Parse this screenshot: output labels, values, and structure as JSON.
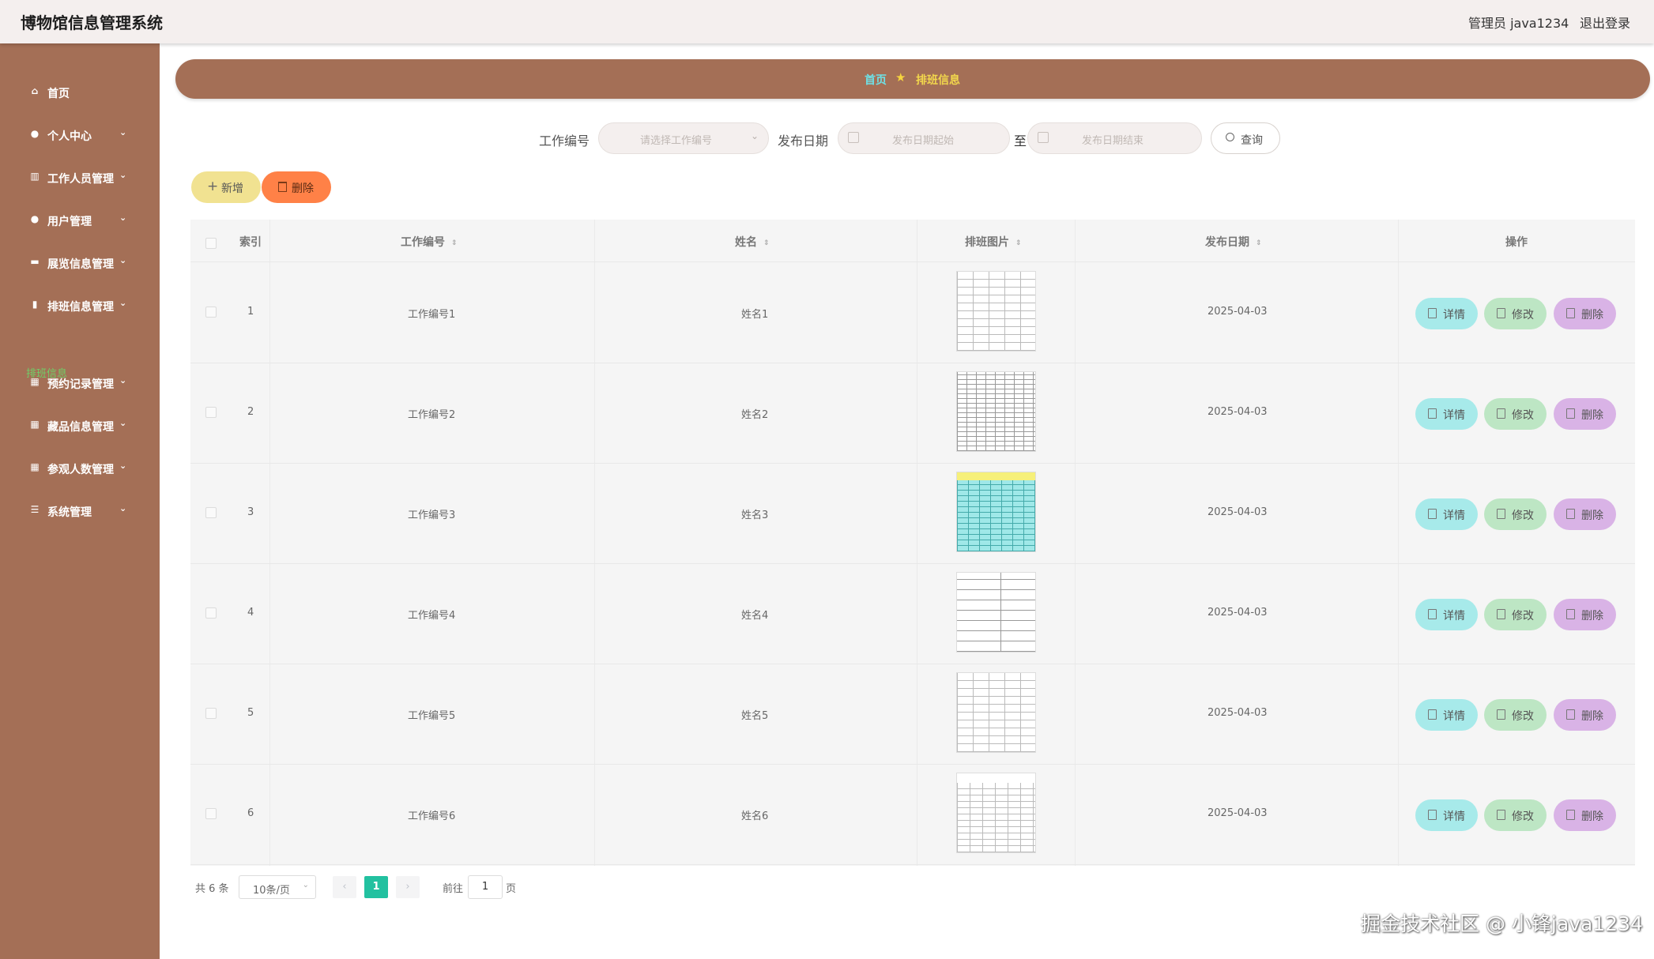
{
  "app": {
    "title": "博物馆信息管理系统",
    "user": "管理员 java1234",
    "logout": "退出登录"
  },
  "sidebar": {
    "items": [
      {
        "label": "首页",
        "icon": "home-icon",
        "expandable": false
      },
      {
        "label": "个人中心",
        "icon": "user-icon",
        "expandable": true
      },
      {
        "label": "工作人员管理",
        "icon": "chart-icon",
        "expandable": true
      },
      {
        "label": "用户管理",
        "icon": "pin-icon",
        "expandable": true
      },
      {
        "label": "展览信息管理",
        "icon": "monitor-icon",
        "expandable": true
      },
      {
        "label": "排班信息管理",
        "icon": "bar-chart-icon",
        "expandable": true
      },
      {
        "label": "预约记录管理",
        "icon": "grid-icon",
        "expandable": true
      },
      {
        "label": "藏品信息管理",
        "icon": "grid-icon",
        "expandable": true
      },
      {
        "label": "参观人数管理",
        "icon": "grid-icon",
        "expandable": true
      },
      {
        "label": "系统管理",
        "icon": "list-icon",
        "expandable": true
      }
    ],
    "active_sub": "排班信息"
  },
  "breadcrumb": {
    "home": "首页",
    "current": "排班信息"
  },
  "search": {
    "work_no_label": "工作编号",
    "work_no_placeholder": "请选择工作编号",
    "date_label": "发布日期",
    "date_start_placeholder": "发布日期起始",
    "date_sep": "至",
    "date_end_placeholder": "发布日期结束",
    "query_label": "查询"
  },
  "actions": {
    "add_label": "新增",
    "delete_label": "删除"
  },
  "table": {
    "headers": {
      "index": "索引",
      "work_no": "工作编号",
      "name": "姓名",
      "image": "排班图片",
      "date": "发布日期",
      "ops": "操作"
    },
    "rows": [
      {
        "index": "1",
        "work_no": "工作编号1",
        "name": "姓名1",
        "date": "2025-04-03"
      },
      {
        "index": "2",
        "work_no": "工作编号2",
        "name": "姓名2",
        "date": "2025-04-03"
      },
      {
        "index": "3",
        "work_no": "工作编号3",
        "name": "姓名3",
        "date": "2025-04-03"
      },
      {
        "index": "4",
        "work_no": "工作编号4",
        "name": "姓名4",
        "date": "2025-04-03"
      },
      {
        "index": "5",
        "work_no": "工作编号5",
        "name": "姓名5",
        "date": "2025-04-03"
      },
      {
        "index": "6",
        "work_no": "工作编号6",
        "name": "姓名6",
        "date": "2025-04-03"
      }
    ],
    "row_actions": {
      "detail": "详情",
      "edit": "修改",
      "delete": "删除"
    }
  },
  "pagination": {
    "total": "共 6 条",
    "page_size": "10条/页",
    "current_page": "1",
    "goto_label": "前往",
    "goto_value": "1",
    "page_suffix": "页"
  },
  "watermark": "掘金技术社区 @ 小锋java1234",
  "colors": {
    "sidebar": "#a46f56",
    "topbar": "#f4efee",
    "add_button": "#f1e291",
    "delete_button": "#ff8147",
    "detail_button": "#a7eaea",
    "edit_button": "#bde6c4",
    "row_delete_button": "#d9b3e6",
    "active_page": "#22c1a0"
  }
}
